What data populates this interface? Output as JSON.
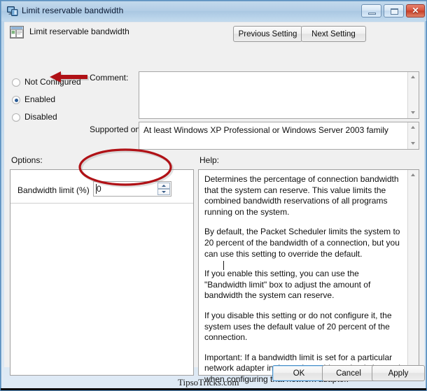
{
  "window": {
    "title": "Limit reservable bandwidth",
    "icon": "computer-monitor-icon",
    "minimize_label": "Minimize",
    "maximize_label": "Maximize",
    "close_label": "Close",
    "close_glyph": "✕"
  },
  "header": {
    "icon": "policy-window-icon",
    "title": "Limit reservable bandwidth",
    "previous_setting": "Previous Setting",
    "next_setting": "Next Setting"
  },
  "state": {
    "options": [
      {
        "label": "Not Configured",
        "selected": false
      },
      {
        "label": "Enabled",
        "selected": true
      },
      {
        "label": "Disabled",
        "selected": false
      }
    ]
  },
  "comment": {
    "label": "Comment:",
    "value": ""
  },
  "supported": {
    "label": "Supported on:",
    "value": "At least Windows XP Professional or Windows Server 2003 family"
  },
  "options_panel": {
    "label": "Options:",
    "setting_label": "Bandwidth limit (%)",
    "setting_value": "0"
  },
  "help_panel": {
    "label": "Help:",
    "paragraphs": [
      "Determines the percentage of connection bandwidth that the system can reserve. This value limits the combined bandwidth reservations of all programs running on the system.",
      "By default, the Packet Scheduler limits the system to 20 percent of the bandwidth of a connection, but you can use this setting to override the default.",
      "If you enable this setting, you can use the \"Bandwidth limit\" box to adjust the amount of bandwidth the system can reserve.",
      "If you disable this setting or do not configure it, the system uses the default value of 20 percent of the connection.",
      "Important: If a bandwidth limit is set for a particular network adapter in the registry, this setting is ignored when configuring that network adapter."
    ]
  },
  "footer": {
    "ok": "OK",
    "cancel": "Cancel",
    "apply": "Apply"
  },
  "watermark": {
    "text": "TipsoTricks.com"
  },
  "annotations": {
    "color": "#b01116",
    "arrow_target": "Enabled",
    "ellipse_target": "Bandwidth limit (%) spinner"
  }
}
